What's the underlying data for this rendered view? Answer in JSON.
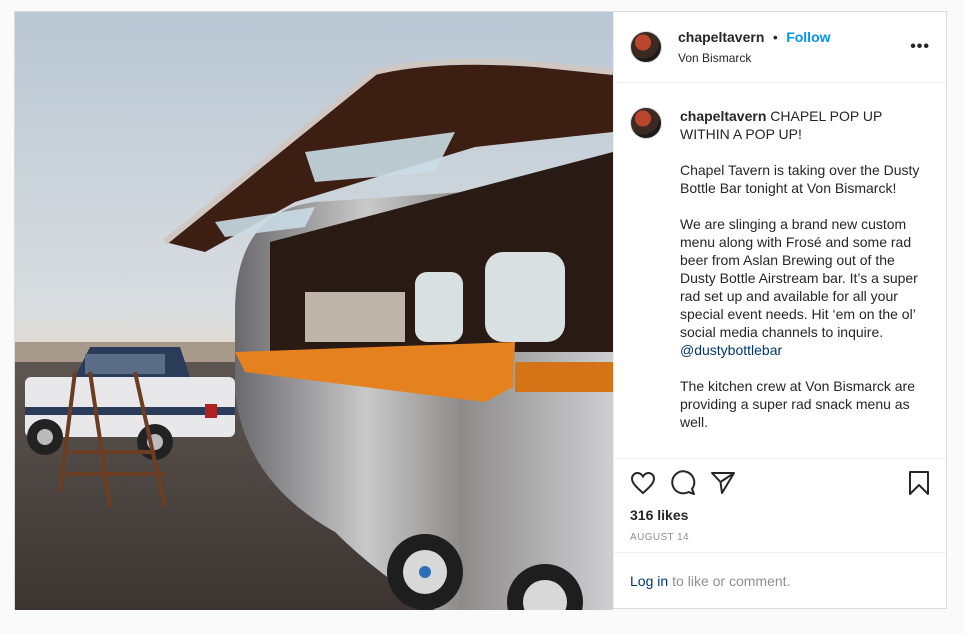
{
  "post": {
    "username": "chapeltavern",
    "separator": "•",
    "follow_label": "Follow",
    "location": "Von Bismarck",
    "more_icon": "more-horizontal-icon",
    "more_label": "•••"
  },
  "caption": {
    "username": "chapeltavern",
    "line1": "CHAPEL POP UP WITHIN A POP UP!",
    "para2": "Chapel Tavern is taking over the Dusty Bottle Bar tonight at Von Bismarck!",
    "para3_text": "We are slinging a brand new custom menu along with Frosé and some rad beer from Aslan Brewing out of the Dusty Bottle Airstream bar. It’s a super rad set up and available for all your special event needs. Hit ‘em on the ol’ social media channels to inquire.",
    "para3_mention": "@dustybottlebar",
    "para4": "The kitchen crew at Von Bismarck are providing a super rad snack menu as well."
  },
  "actions": {
    "icons": [
      "heart-icon",
      "comment-icon",
      "share-icon",
      "bookmark-icon"
    ],
    "likes": "316 likes",
    "date": "AUGUST 14"
  },
  "login": {
    "link": "Log in",
    "text": "to like or comment."
  }
}
